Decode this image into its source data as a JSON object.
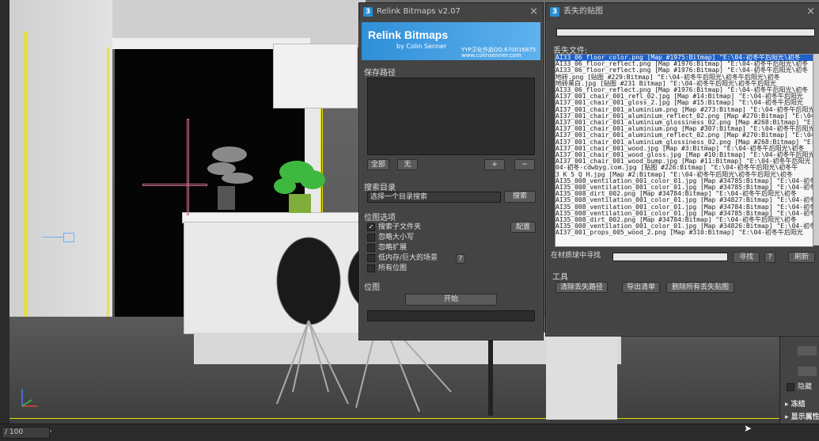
{
  "viewport": {
    "frame_counter": "/ 100"
  },
  "relink_panel": {
    "title": "Relink Bitmaps v2.07",
    "banner_title": "Relink Bitmaps",
    "banner_author": "by Colin Senner",
    "banner_credit": "YYP汉化作品QQ:670016875",
    "banner_site": "www.colinsenner.com",
    "save_path_group": "保存路径",
    "btn_all": "全部",
    "btn_none": "无",
    "btn_add": "+",
    "btn_remove": "−",
    "search_dir_group": "搜索目录",
    "search_dir_value": "选择一个目录搜索",
    "btn_search": "搜索",
    "bitmap_options_group": "位图选项",
    "btn_config": "配置",
    "options": [
      {
        "label": "搜索子文件夹",
        "checked": true
      },
      {
        "label": "忽略大小写",
        "checked": false
      },
      {
        "label": "忽略扩展",
        "checked": false
      },
      {
        "label": "低内存/巨大的场景",
        "checked": false
      },
      {
        "label": "所有位图",
        "checked": false
      }
    ],
    "help_mark": "?",
    "bitmap_group": "位图",
    "btn_start": "开始"
  },
  "missing_panel": {
    "title": "丢失的贴图",
    "missing_files_label": "丢失文件:",
    "files": [
      "AI33_06_floor_color.png  [Map #1975:Bitmap]  \"E:\\04-初冬午后阳光\\初冬",
      "AI33_06_floor_reflect.png  [Map #1976:Bitmap]  \"E:\\04-初冬午后阳光\\初冬",
      "AI33_06_floor_reflect.png  [Map #1976:Bitmap]  \"E:\\04-初冬午后阳光\\初冬",
      "地砖.png  [贴图 #229:Bitmap]  \"E:\\04-初冬午后阳光\\初冬午后阳光\\初冬",
      "地砖黑白.jpg  [贴图 #231 Bitmap]  \"E:\\04-初冬午后阳光\\初冬午后阳光",
      "AI33_06_floor_reflect.png  [Map #1976:Bitmap]  \"E:\\04-初冬午后阳光\\初冬",
      "AI37_001_chair_001_refl_02.jpg  [Map #14:Bitmap]  \"E:\\04-初冬午后阳光",
      "AI37_001_chair_001_gloss_2.jpg  [Map #15:Bitmap]  \"E:\\04-初冬午后阳光",
      "AI37_001_chair_001_aluminium.png  [Map #273:Bitmap]  \"E:\\04-初冬午后阳光",
      "AI37_001_chair_001_aluminium_reflect_02.png  [Map #270:Bitmap]  \"E:\\04-",
      "AI37_001_chair_001_aluminium_glossiness_02.png  [Map #268:Bitmap]  \"E:\\04-",
      "AI37_001_chair_001_aluminium.png  [Map #307:Bitmap]  \"E:\\04-初冬午后阳光",
      "AI37_001_chair_001_aluminium_reflect_02.png  [Map #270:Bitmap]  \"E:\\04-",
      "AI37_001_chair_001_aluminium_glossiness_02.png  [Map #268:Bitmap]  \"E:\\04-",
      "AI37_001_chair_001_wood.jpg  [Map #3:Bitmap]  \"E:\\04-初冬午后阳光\\初冬",
      "AI37_001_chair_001_wood_gloss.jpg  [Map #10:Bitmap]  \"E:\\04-初冬午后阳光",
      "AI37_001_chair_001_wood_bump.jpg  [Map #11:Bitmap]  \"E:\\04-初冬午后阳光",
      "04-初冬-cdwbyg.com.jpg  [贴图 #226:Bitmap]  \"E:\\04-初冬午后阳光\\初冬午",
      "3 K 5 Q H.jpg  [Map #2:Bitmap]  \"E:\\04-初冬午后阳光\\初冬午后阳光\\初冬",
      "AI35_008_ventilation_001_color_01.jpg  [Map #34785:Bitmap]  \"E:\\04-初冬",
      "AI35_008_ventilation_001_color_01.jpg  [Map #34785:Bitmap]  \"E:\\04-初冬",
      "AI35_008_dirt_002.png  [Map #34784:Bitmap]  \"E:\\04-初冬午后阳光\\初冬",
      "AI35_008_ventilation_001_color_01.jpg  [Map #34827:Bitmap]  \"E:\\04-初冬",
      "AI35_008_ventilation_001_color_01.jpg  [Map #34784:Bitmap]  \"E:\\04-初冬",
      "AI35_008_ventilation_001_color_01.jpg  [Map #34785:Bitmap]  \"E:\\04-初冬",
      "AI35_008_dirt_002.png  [Map #34784:Bitmap]  \"E:\\04-初冬午后阳光\\初冬",
      "AI35_008_ventilation_001_color_01.jpg  [Map #34826:Bitmap]  \"E:\\04-初冬",
      "AI37_001_props_005_wood_2.png  [Map #310:Bitmap]  \"E:\\04-初冬午后阳光"
    ],
    "find_in_material_label": "在材质球中寻找",
    "btn_find": "寻找",
    "help_mark": "?",
    "btn_refresh": "刷新",
    "tools_label": "工具",
    "btn_clear_paths": "清除丢失路径",
    "btn_export_list": "导出清单",
    "btn_delete_all": "删除所有丢失贴图"
  },
  "right_panel": {
    "hide_label": "隐藏",
    "freeze_label": "冻结",
    "display_label": "显示属性"
  },
  "colors": {
    "selection": "#1f60c8",
    "banner": "#2f8fd8",
    "viewport_border": "#e6e000"
  }
}
